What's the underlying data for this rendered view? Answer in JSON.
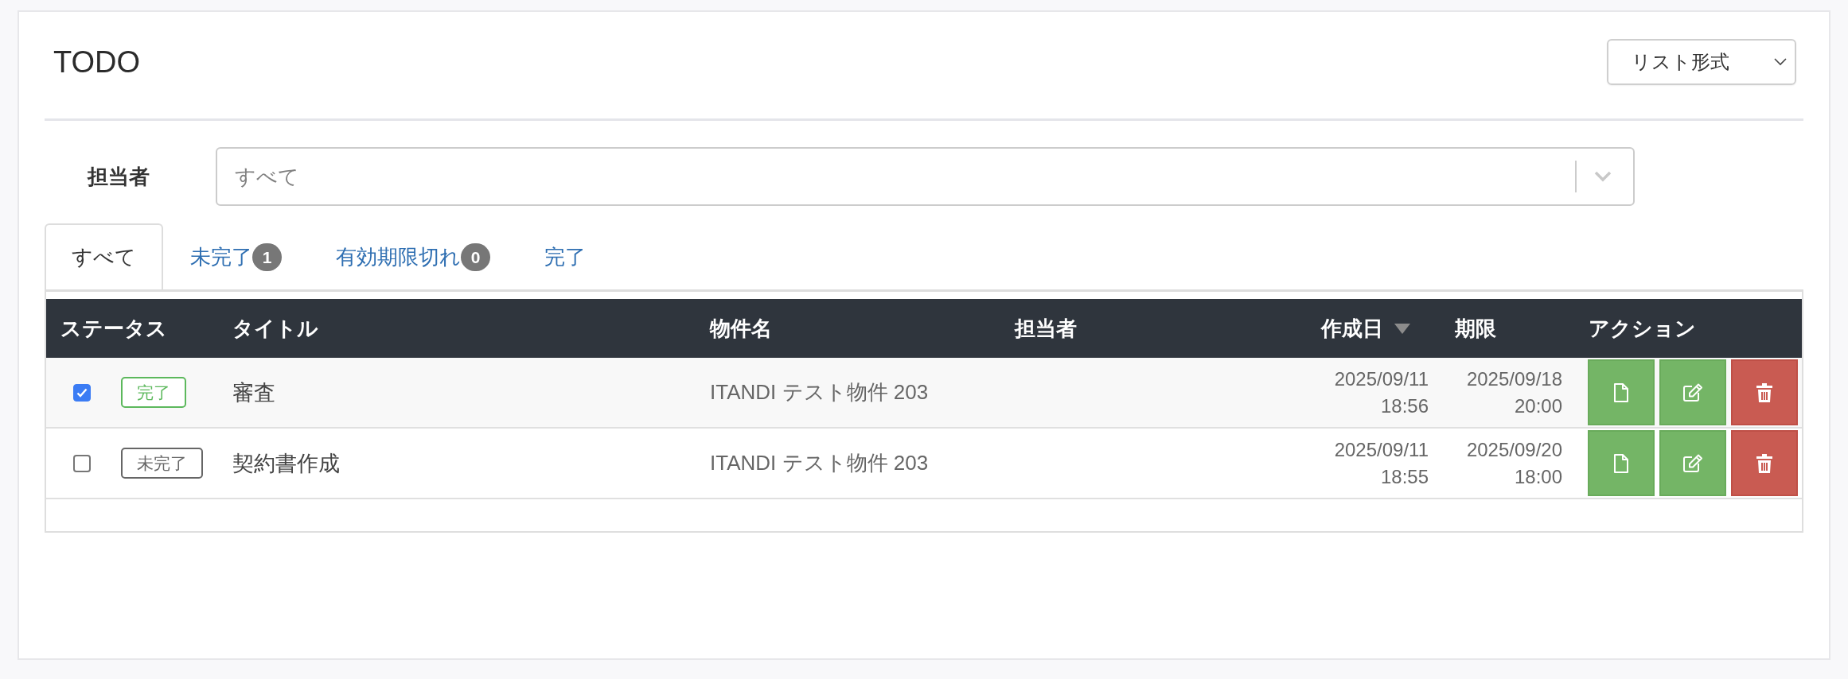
{
  "header": {
    "title": "TODO",
    "view_select": {
      "value": "リスト形式"
    }
  },
  "filter": {
    "label": "担当者",
    "select": {
      "placeholder": "すべて"
    }
  },
  "tabs": [
    {
      "label": "すべて",
      "selected": true
    },
    {
      "label": "未完了",
      "badge": "1",
      "selected": false
    },
    {
      "label": "有効期限切れ",
      "badge": "0",
      "selected": false
    },
    {
      "label": "完了",
      "selected": false
    }
  ],
  "table": {
    "columns": [
      {
        "label": "ステータス",
        "sorted": false
      },
      {
        "label": "タイトル",
        "sorted": false
      },
      {
        "label": "物件名",
        "sorted": false
      },
      {
        "label": "担当者",
        "sorted": false
      },
      {
        "label": "作成日",
        "sorted": true
      },
      {
        "label": "期限",
        "sorted": false
      },
      {
        "label": "アクション",
        "sorted": false
      }
    ],
    "rows": [
      {
        "checked": true,
        "status": {
          "label": "完了",
          "color": "#5cb85c"
        },
        "title": "審査",
        "property": "ITANDI テスト物件 203",
        "created": "2025/09/11 18:56",
        "due": "2025/09/18 20:00",
        "actions": [
          {
            "kind": "view"
          },
          {
            "kind": "edit"
          },
          {
            "kind": "delete"
          }
        ]
      },
      {
        "checked": false,
        "status": {
          "label": "未完了",
          "color": "#666666"
        },
        "title": "契約書作成",
        "property": "ITANDI テスト物件 203",
        "created": "2025/09/11 18:55",
        "due": "2025/09/20 18:00",
        "actions": [
          {
            "kind": "view"
          },
          {
            "kind": "edit"
          },
          {
            "kind": "delete"
          }
        ]
      }
    ]
  }
}
